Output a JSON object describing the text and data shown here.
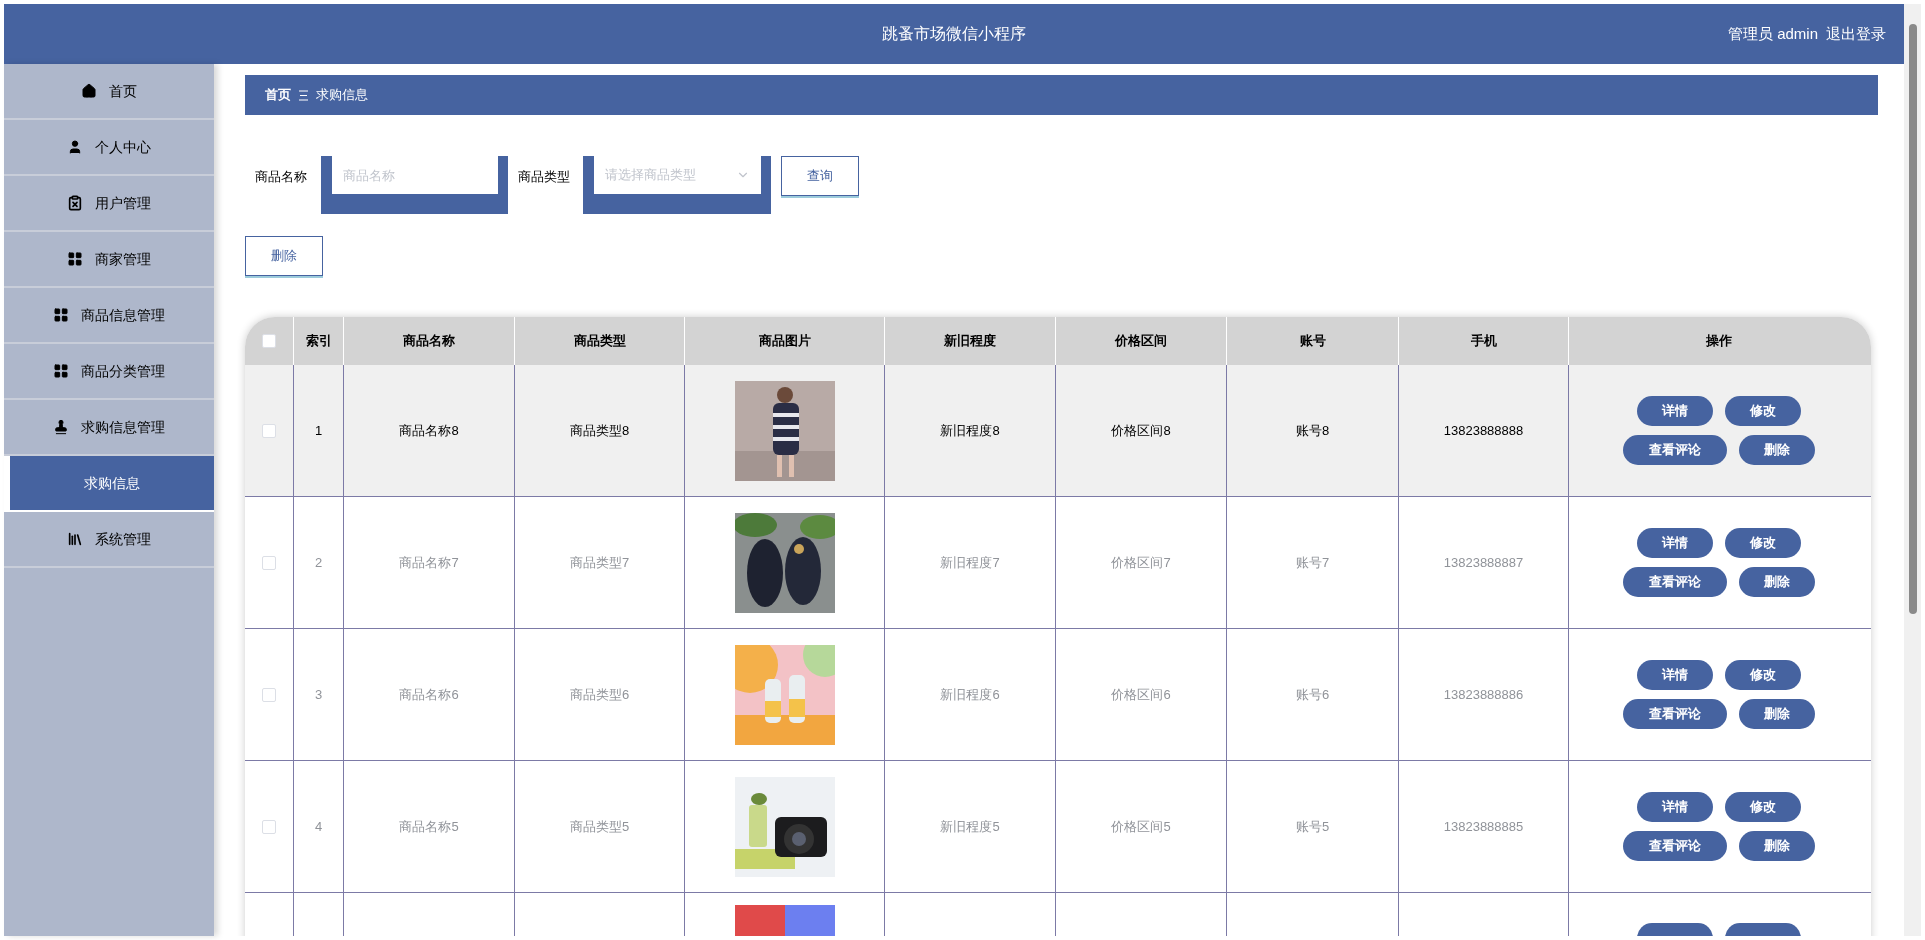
{
  "header": {
    "title": "跳蚤市场微信小程序",
    "user": "管理员 admin",
    "logout": "退出登录"
  },
  "sidebar": {
    "items": [
      {
        "label": "首页",
        "kind": "home",
        "selected": false
      },
      {
        "label": "个人中心",
        "kind": "user",
        "selected": false
      },
      {
        "label": "用户管理",
        "kind": "clipboard",
        "selected": false
      },
      {
        "label": "商家管理",
        "kind": "grid",
        "selected": false
      },
      {
        "label": "商品信息管理",
        "kind": "grid",
        "selected": false
      },
      {
        "label": "商品分类管理",
        "kind": "grid",
        "selected": false
      },
      {
        "label": "求购信息管理",
        "kind": "stamp",
        "selected": false
      },
      {
        "label": "求购信息",
        "kind": "sub",
        "selected": true
      },
      {
        "label": "系统管理",
        "kind": "library",
        "selected": false
      }
    ]
  },
  "breadcrumb": {
    "home": "首页",
    "current": "求购信息"
  },
  "search": {
    "name_label": "商品名称",
    "name_placeholder": "商品名称",
    "type_label": "商品类型",
    "type_placeholder": "请选择商品类型",
    "query_button": "查询"
  },
  "delete_button": "删除",
  "table": {
    "select_all_checked": false,
    "columns": [
      "索引",
      "商品名称",
      "商品类型",
      "商品图片",
      "新旧程度",
      "价格区间",
      "账号",
      "手机",
      "操作"
    ],
    "rows": [
      {
        "checked": false,
        "highlighted": true,
        "cells": [
          "1",
          "商品名称8",
          "商品类型8",
          "新旧程度8",
          "价格区间8",
          "账号8",
          "13823888888"
        ],
        "picture": {
          "kind": "picture"
        },
        "actions": [
          "详情",
          "修改",
          "查看评论",
          "删除"
        ]
      },
      {
        "checked": false,
        "highlighted": false,
        "cells": [
          "2",
          "商品名称7",
          "商品类型7",
          "新旧程度7",
          "价格区间7",
          "账号7",
          "13823888887"
        ],
        "picture": {
          "kind": "picture"
        },
        "actions": [
          "详情",
          "修改",
          "查看评论",
          "删除"
        ]
      },
      {
        "checked": false,
        "highlighted": false,
        "cells": [
          "3",
          "商品名称6",
          "商品类型6",
          "新旧程度6",
          "价格区间6",
          "账号6",
          "13823888886"
        ],
        "picture": {
          "kind": "picture"
        },
        "actions": [
          "详情",
          "修改",
          "查看评论",
          "删除"
        ]
      },
      {
        "checked": false,
        "highlighted": false,
        "cells": [
          "4",
          "商品名称5",
          "商品类型5",
          "新旧程度5",
          "价格区间5",
          "账号5",
          "13823888885"
        ],
        "picture": {
          "kind": "picture"
        },
        "actions": [
          "详情",
          "修改",
          "查看评论",
          "删除"
        ]
      },
      {
        "picture": {
          "kind": "picture"
        }
      }
    ]
  }
}
